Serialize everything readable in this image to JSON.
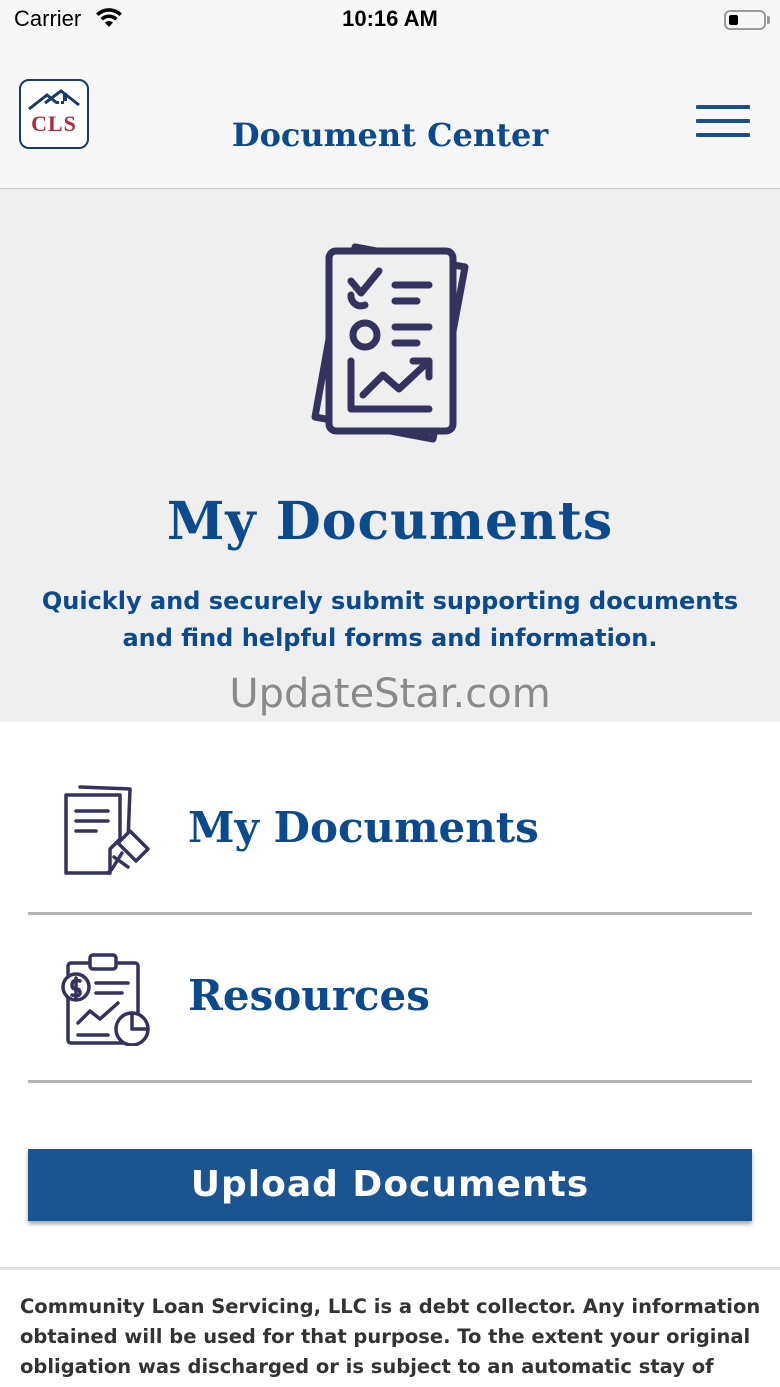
{
  "status_bar": {
    "carrier": "Carrier",
    "time": "10:16 AM"
  },
  "header": {
    "logo_text": "CLS",
    "title": "Document Center",
    "menu_icon": "hamburger-menu-icon"
  },
  "hero": {
    "icon": "checklist-document-icon",
    "title": "My Documents",
    "subtitle": "Quickly and securely submit supporting documents and find helpful forms and information.",
    "watermark": "UpdateStar.com"
  },
  "menu": {
    "items": [
      {
        "label": "My Documents",
        "icon": "documents-pin-icon"
      },
      {
        "label": "Resources",
        "icon": "clipboard-finance-icon"
      }
    ]
  },
  "actions": {
    "upload_label": "Upload Documents"
  },
  "footer": {
    "disclaimer": "Community Loan Servicing, LLC is a debt collector. Any information obtained will be used for that purpose. To the extent your original obligation was discharged or is subject to an automatic stay of"
  },
  "colors": {
    "brand_blue": "#0b4a8c",
    "button_blue": "#1a5592",
    "icon_navy": "#33335e",
    "logo_red": "#b02a3a"
  }
}
